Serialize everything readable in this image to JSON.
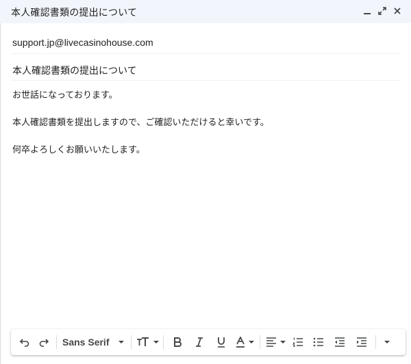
{
  "header": {
    "title": "本人確認書類の提出について",
    "controls": [
      "minimize-icon",
      "expand-icon",
      "close-icon"
    ]
  },
  "recipients": {
    "to": "support.jp@livecasinohouse.com"
  },
  "subject": "本人確認書類の提出について",
  "body": {
    "lines": [
      "お世話になっております。",
      "本人確認書類を提出しますので、ご確認いただけると幸いです。",
      "何卒よろしくお願いいたします。"
    ]
  },
  "toolbar": {
    "font_family": "Sans Serif",
    "buttons": [
      "undo-icon",
      "redo-icon",
      "text-size-icon",
      "bold-icon",
      "italic-icon",
      "underline-icon",
      "text-color-icon",
      "align-icon",
      "numbered-list-icon",
      "bulleted-list-icon",
      "indent-less-icon",
      "indent-more-icon",
      "more-formatting-icon"
    ]
  },
  "colors": {
    "header_bg": "#f2f6fc",
    "text": "#202124",
    "icon": "#444746"
  }
}
